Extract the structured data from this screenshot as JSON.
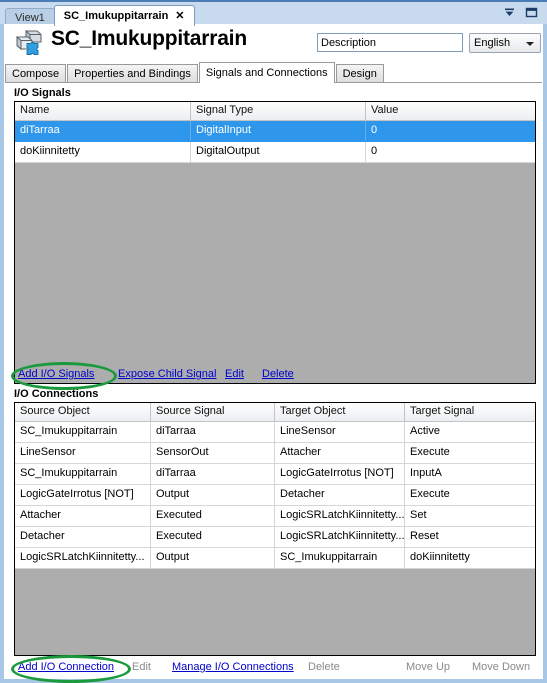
{
  "window": {
    "buttons": [
      {
        "name": "tab-list-dropdown",
        "icon": "chevron-down-bar-icon"
      },
      {
        "name": "restore-window",
        "icon": "window-restore-icon"
      }
    ]
  },
  "document_tabs": [
    {
      "label": "View1",
      "active": false,
      "closable": false
    },
    {
      "label": "SC_Imukuppitarrain",
      "active": true,
      "closable": true,
      "close_glyph": "✕"
    }
  ],
  "header": {
    "icon": "smart-component-icon",
    "title": "SC_Imukuppitarrain",
    "description_value": "Description",
    "description_placeholder": "Description",
    "language_value": "English",
    "language_options": [
      "English"
    ]
  },
  "property_tabs": [
    {
      "label": "Compose",
      "active": false
    },
    {
      "label": "Properties and Bindings",
      "active": false
    },
    {
      "label": "Signals and Connections",
      "active": true
    },
    {
      "label": "Design",
      "active": false
    }
  ],
  "signals_section": {
    "label": "I/O Signals",
    "columns": [
      "Name",
      "Signal Type",
      "Value"
    ],
    "rows": [
      {
        "name": "diTarraa",
        "signal_type": "DigitalInput",
        "value": "0",
        "selected": true
      },
      {
        "name": "doKiinnitetty",
        "signal_type": "DigitalOutput",
        "value": "0",
        "selected": false
      }
    ],
    "actions": [
      {
        "label": "Add I/O Signals",
        "enabled": true,
        "highlighted": true
      },
      {
        "label": "Expose Child Signal",
        "enabled": true,
        "highlighted": false
      },
      {
        "label": "Edit",
        "enabled": true,
        "highlighted": false
      },
      {
        "label": "Delete",
        "enabled": true,
        "highlighted": false
      }
    ]
  },
  "connections_section": {
    "label": "I/O Connections",
    "columns": [
      "Source Object",
      "Source Signal",
      "Target Object",
      "Target Signal"
    ],
    "rows": [
      {
        "source_object": "SC_Imukuppitarrain",
        "source_signal": "diTarraa",
        "target_object": "LineSensor",
        "target_signal": "Active"
      },
      {
        "source_object": "LineSensor",
        "source_signal": "SensorOut",
        "target_object": "Attacher",
        "target_signal": "Execute"
      },
      {
        "source_object": "SC_Imukuppitarrain",
        "source_signal": "diTarraa",
        "target_object": "LogicGateIrrotus [NOT]",
        "target_signal": "InputA"
      },
      {
        "source_object": "LogicGateIrrotus [NOT]",
        "source_signal": "Output",
        "target_object": "Detacher",
        "target_signal": "Execute"
      },
      {
        "source_object": "Attacher",
        "source_signal": "Executed",
        "target_object": "LogicSRLatchKiinnitetty...",
        "target_signal": "Set"
      },
      {
        "source_object": "Detacher",
        "source_signal": "Executed",
        "target_object": "LogicSRLatchKiinnitetty...",
        "target_signal": "Reset"
      },
      {
        "source_object": "LogicSRLatchKiinnitetty...",
        "source_signal": "Output",
        "target_object": "SC_Imukuppitarrain",
        "target_signal": "doKiinnitetty"
      }
    ],
    "actions": [
      {
        "label": "Add I/O Connection",
        "enabled": true,
        "highlighted": true
      },
      {
        "label": "Edit",
        "enabled": false,
        "highlighted": false
      },
      {
        "label": "Manage I/O Connections",
        "enabled": true,
        "highlighted": false
      },
      {
        "label": "Delete",
        "enabled": false,
        "highlighted": false
      },
      {
        "label": "Move Up",
        "enabled": false,
        "highlighted": false
      },
      {
        "label": "Move Down",
        "enabled": false,
        "highlighted": false
      }
    ]
  },
  "colors": {
    "titlebar": "#c8daee",
    "frame_border": "#a8c6e5",
    "selection": "#2e97ec",
    "grid_empty": "#adadad",
    "link": "#0000cc",
    "disabled_text": "#8a8a8a",
    "annotation": "#1a9a3c"
  }
}
